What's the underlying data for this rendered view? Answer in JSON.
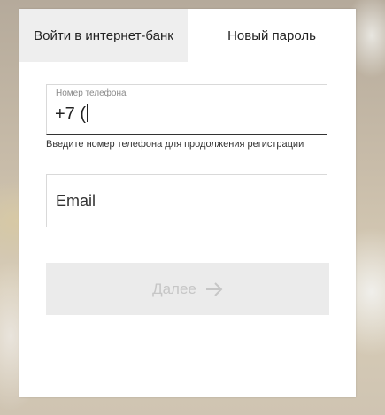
{
  "tabs": [
    {
      "label": "Войти в интернет-банк"
    },
    {
      "label": "Новый пароль"
    }
  ],
  "phone": {
    "label": "Номер телефона",
    "value": "+7 ("
  },
  "hint": "Введите номер телефона для продолжения регистрации",
  "email": {
    "placeholder": "Email",
    "value": ""
  },
  "submit": {
    "label": "Далее",
    "enabled": false
  },
  "colors": {
    "card": "#ffffff",
    "inactive_tab": "#eeeeee",
    "button_disabled": "#ebebeb",
    "button_text_disabled": "#c6c6c6"
  }
}
